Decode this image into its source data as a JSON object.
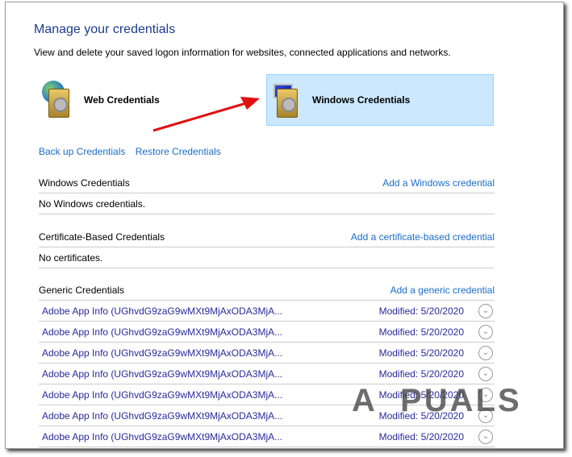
{
  "header": {
    "title": "Manage your credentials",
    "description": "View and delete your saved logon information for websites, connected applications and networks."
  },
  "categories": [
    {
      "label": "Web Credentials",
      "icon": "web-credentials-icon"
    },
    {
      "label": "Windows Credentials",
      "icon": "windows-credentials-icon",
      "selected": true
    }
  ],
  "links": {
    "backup": "Back up Credentials",
    "restore": "Restore Credentials"
  },
  "sections": {
    "windows": {
      "title": "Windows Credentials",
      "action": "Add a Windows credential",
      "empty": "No Windows credentials."
    },
    "certificate": {
      "title": "Certificate-Based Credentials",
      "action": "Add a certificate-based credential",
      "empty": "No certificates."
    },
    "generic": {
      "title": "Generic Credentials",
      "action": "Add a generic credential",
      "items": [
        {
          "name": "Adobe App Info (UGhvdG9zaG9wMXt9MjAxODA3MjA...",
          "modified": "Modified:  5/20/2020"
        },
        {
          "name": "Adobe App Info (UGhvdG9zaG9wMXt9MjAxODA3MjA...",
          "modified": "Modified:  5/20/2020"
        },
        {
          "name": "Adobe App Info (UGhvdG9zaG9wMXt9MjAxODA3MjA...",
          "modified": "Modified:  5/20/2020"
        },
        {
          "name": "Adobe App Info (UGhvdG9zaG9wMXt9MjAxODA3MjA...",
          "modified": "Modified:  5/20/2020"
        },
        {
          "name": "Adobe App Info (UGhvdG9zaG9wMXt9MjAxODA3MjA...",
          "modified": "Modified:  5/20/2020"
        },
        {
          "name": "Adobe App Info (UGhvdG9zaG9wMXt9MjAxODA3MjA...",
          "modified": "Modified:  5/20/2020"
        },
        {
          "name": "Adobe App Info (UGhvdG9zaG9wMXt9MjAxODA3MjA...",
          "modified": "Modified:  5/20/2020"
        }
      ]
    }
  },
  "watermark": "APPUALS"
}
